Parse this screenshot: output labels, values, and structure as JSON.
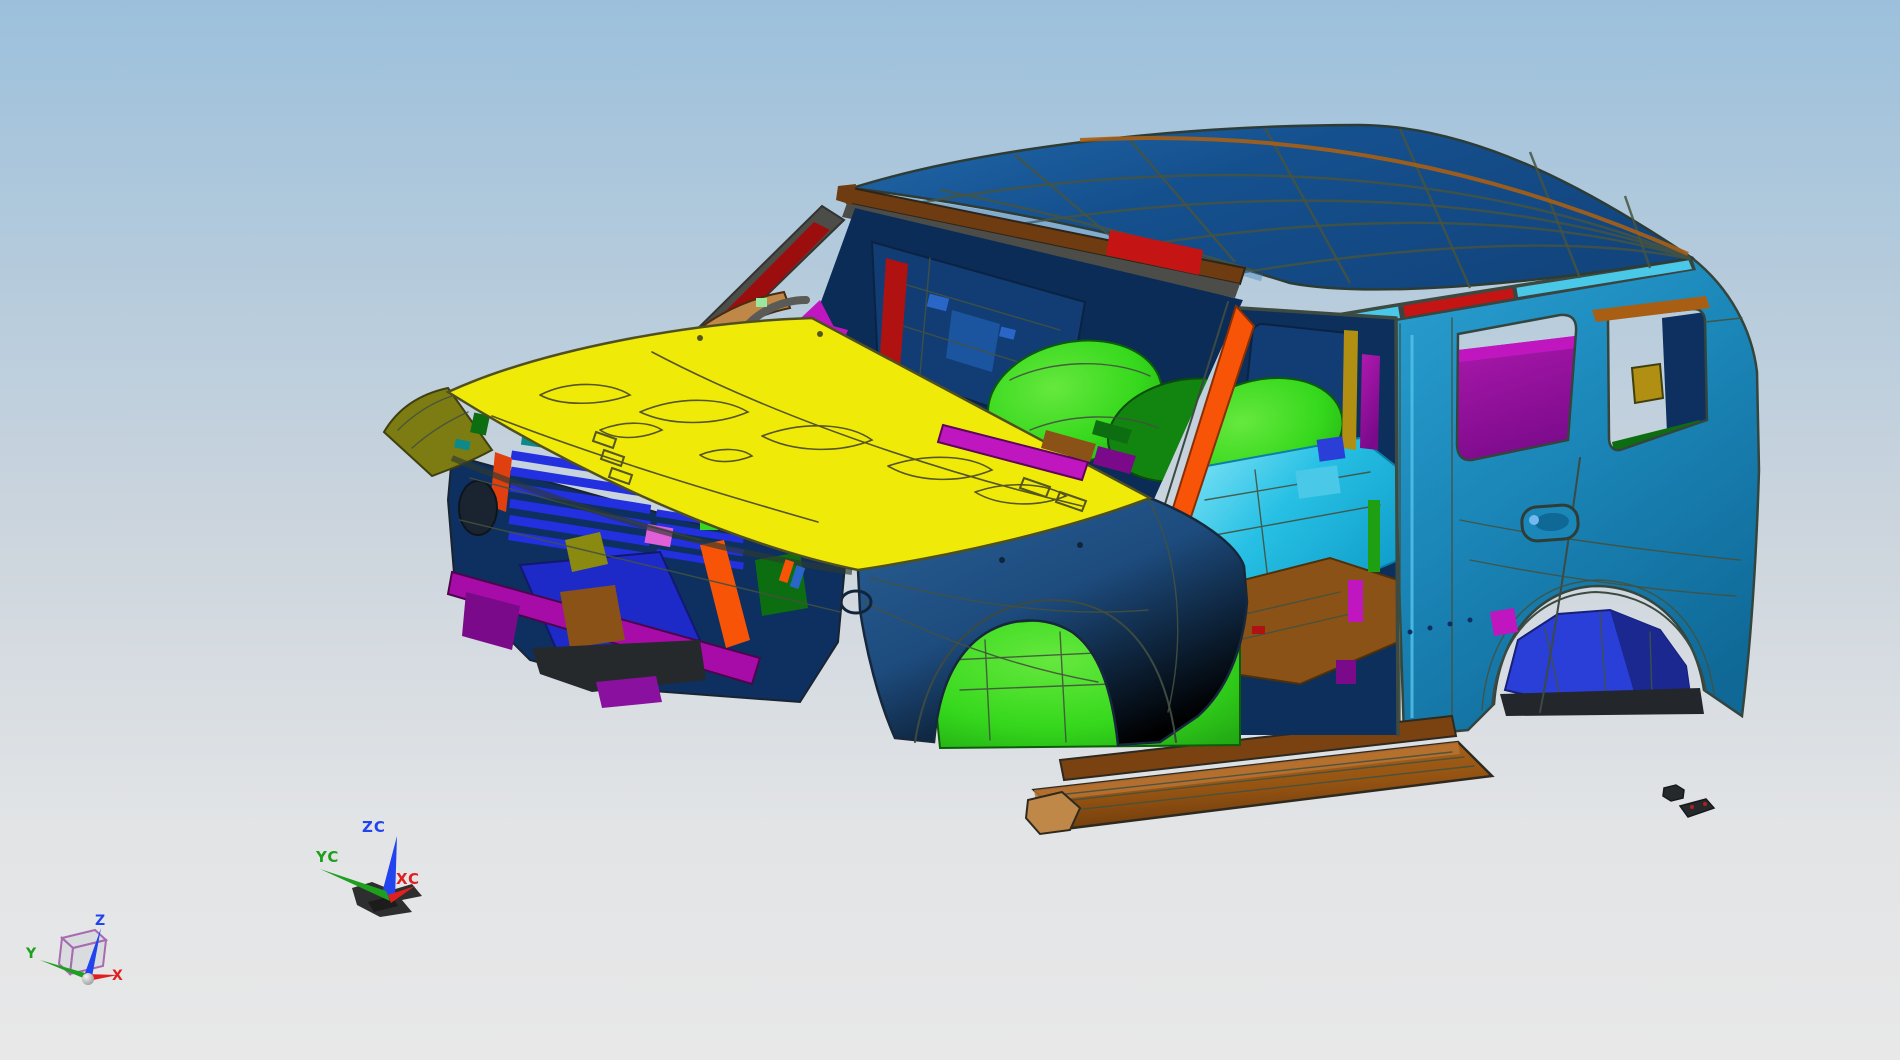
{
  "viewport": {
    "background": {
      "top": "#9cc0dc",
      "middle": "#ccd5dd",
      "bottom": "#e8e8e8"
    },
    "triads": {
      "wcs": {
        "z": "ZC",
        "y": "YC",
        "x": "XC"
      },
      "absolute": {
        "z": "Z",
        "y": "Y",
        "x": "X"
      },
      "axis_colors": {
        "x": "#e02020",
        "y": "#1da01d",
        "z": "#2244ee"
      },
      "cube_line_color": "#a86ab0"
    },
    "palette": {
      "edge": "#3c4a42",
      "roof": "#15508e",
      "roofHi": "#2168aa",
      "hdr": "#6e3c10",
      "copper": "#a85f14",
      "copperHi": "#c08848",
      "hood": "#f0ea08",
      "olive": "#7c7c12",
      "yolive": "#8a8a10",
      "gold": "#b08f12",
      "body": "#2fa9da",
      "bodyMid": "#1b86b8",
      "bodyDk": "#0f6896",
      "ltcyan": "#49c8e8",
      "fender": "#1d4b7d",
      "navy": "#0d3060",
      "panel": "#123d74",
      "panelHi": "#1b55a0",
      "grille": "#2230e0",
      "pblue": "#1e2ac8",
      "royal": "#2a3ed8",
      "bumperMag": "#a80ca8",
      "purple": "#7a0a8a",
      "brightMag": "#c016c0",
      "pink": "#e060d8",
      "orange": "#f85407",
      "red": "#c41414",
      "darkRed": "#9c0e0e",
      "green": "#35d81c",
      "greenMid": "#1ea012",
      "greenDk": "#0c6e10",
      "cyanFloor": "#27c0e4",
      "teal": "#0c8a8a",
      "floorBrn": "#8a5216",
      "board": "#965412",
      "gray": "#4c4c48",
      "dark": "#26292b"
    }
  }
}
